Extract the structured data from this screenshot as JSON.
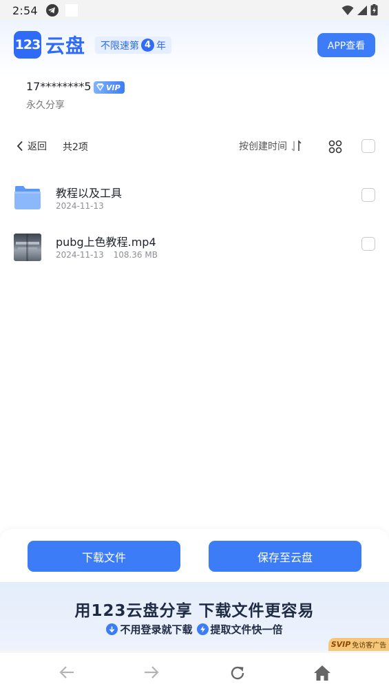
{
  "status_bar": {
    "time": "2:54"
  },
  "header": {
    "logo_mark": "123",
    "logo_text": "云盘",
    "promo_text_before": "不限速第",
    "promo_number": "4",
    "promo_text_after": "年",
    "app_view_label": "APP查看"
  },
  "sharer": {
    "name": "17********5",
    "vip_label": "VIP",
    "share_type": "永久分享"
  },
  "toolbar": {
    "back_label": "返回",
    "item_count": "共2项",
    "sort_label": "按创建时间"
  },
  "files": [
    {
      "name": "教程以及工具",
      "date": "2024-11-13",
      "size": "",
      "type": "folder"
    },
    {
      "name": "pubg上色教程.mp4",
      "date": "2024-11-13",
      "size": "108.36 MB",
      "type": "video"
    }
  ],
  "actions": {
    "download_label": "下载文件",
    "save_label": "保存至云盘"
  },
  "promo_banner": {
    "headline": "用123云盘分享 下载文件更容易",
    "feature_1": "不用登录就下载",
    "feature_2": "提取文件快一倍",
    "ad_svip": "SVIP",
    "ad_text": "免访客广告"
  },
  "colors": {
    "accent": "#3d7cf7",
    "brand": "#2f6bf6"
  }
}
